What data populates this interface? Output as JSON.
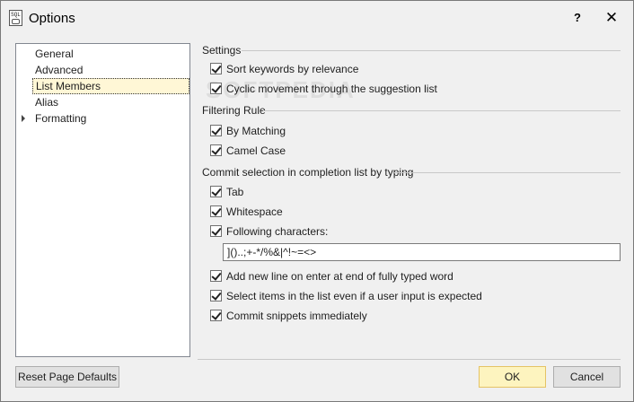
{
  "window": {
    "title": "Options",
    "icon_text": "SQL",
    "help_label": "?",
    "close_label": "✕"
  },
  "nav": {
    "items": [
      {
        "label": "General"
      },
      {
        "label": "Advanced"
      },
      {
        "label": "List Members",
        "selected": true
      },
      {
        "label": "Alias"
      },
      {
        "label": "Formatting",
        "expandable": true
      }
    ]
  },
  "settings": {
    "title": "Settings",
    "options": [
      {
        "label": "Sort keywords by relevance",
        "checked": true
      },
      {
        "label": "Cyclic movement through the suggestion list",
        "checked": true
      }
    ]
  },
  "filtering": {
    "title": "Filtering Rule",
    "options": [
      {
        "label": "By Matching",
        "checked": true
      },
      {
        "label": "Camel Case",
        "checked": true
      }
    ]
  },
  "commit": {
    "title": "Commit selection in completion list by typing",
    "options": [
      {
        "label": "Tab",
        "checked": true
      },
      {
        "label": "Whitespace",
        "checked": true
      },
      {
        "label": "Following characters:",
        "checked": true
      }
    ],
    "characters_value": "]()..;+-*/%&|^!~=<>",
    "extra_options": [
      {
        "label": "Add new line on enter at end of fully typed word",
        "checked": true
      },
      {
        "label": "Select items in the list even if a user input is expected",
        "checked": true
      },
      {
        "label": "Commit snippets immediately",
        "checked": true
      }
    ]
  },
  "buttons": {
    "reset": "Reset Page Defaults",
    "ok": "OK",
    "cancel": "Cancel"
  },
  "watermark": "SOFTPEDIA",
  "colors": {
    "ok_button": "#fdf4bf",
    "selected_item": "#fff7d6"
  }
}
